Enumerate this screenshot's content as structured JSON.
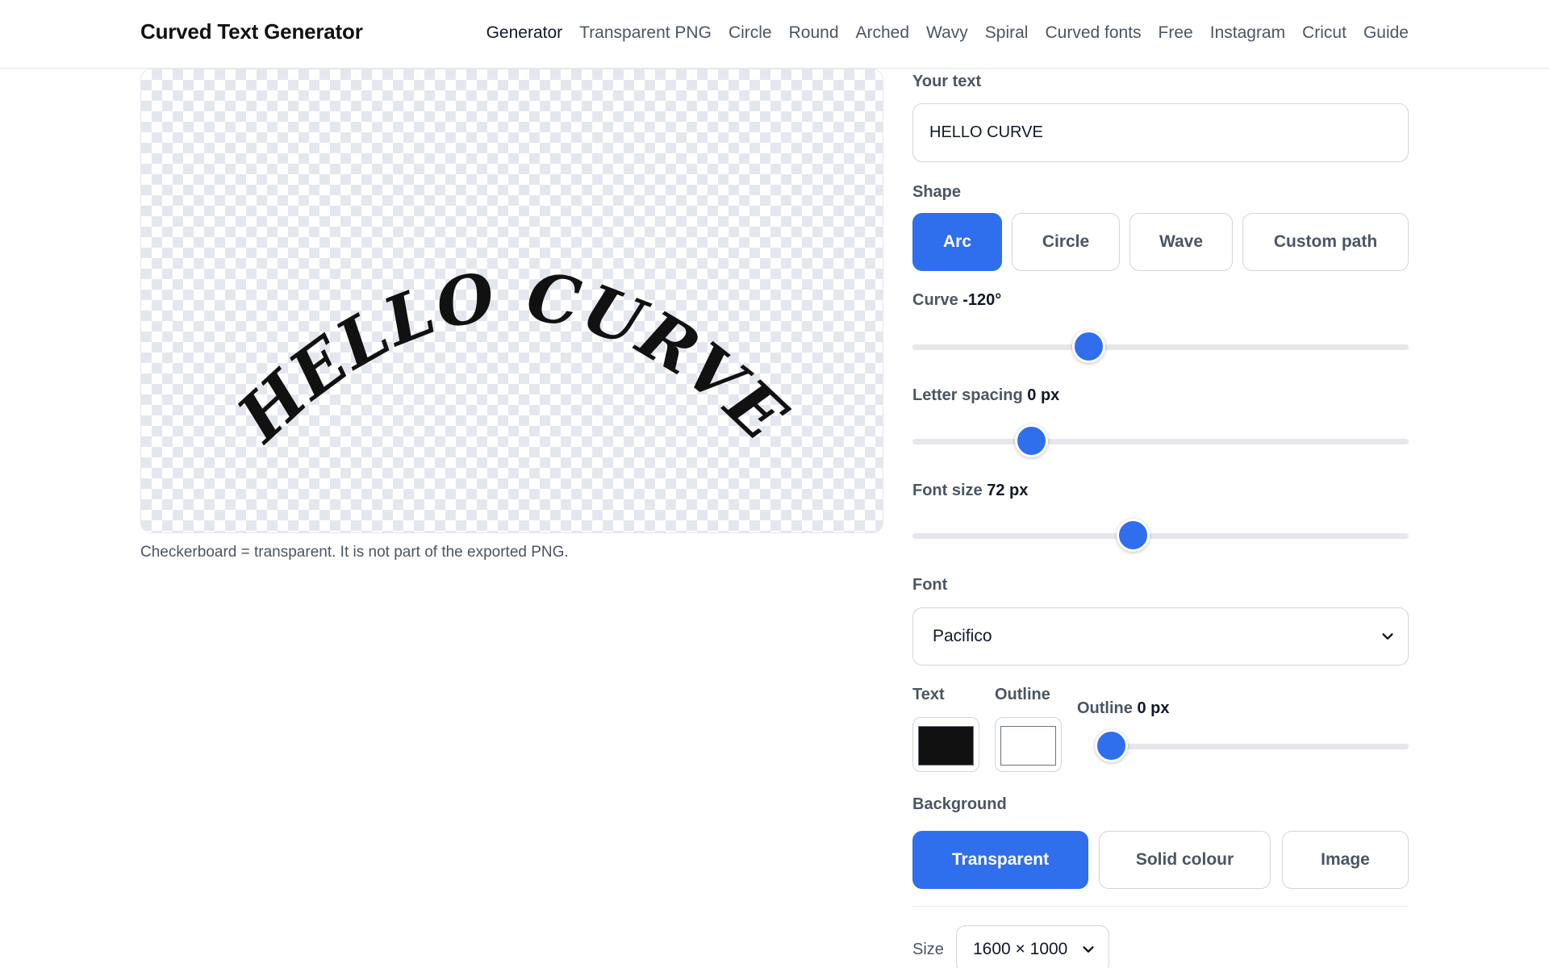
{
  "header": {
    "brand": "Curved Text Generator",
    "nav": [
      "Generator",
      "Transparent PNG",
      "Circle",
      "Round",
      "Arched",
      "Wavy",
      "Spiral",
      "Curved fonts",
      "Free",
      "Instagram",
      "Cricut",
      "Guide"
    ],
    "active_nav": "Generator"
  },
  "preview": {
    "text": "HELLO CURVE",
    "caption": "Checkerboard = transparent. It is not part of the exported PNG."
  },
  "controls": {
    "your_text": {
      "label": "Your text",
      "value": "HELLO CURVE"
    },
    "shape": {
      "label": "Shape",
      "options": [
        "Arc",
        "Circle",
        "Wave",
        "Custom path"
      ],
      "selected": "Arc"
    },
    "curve": {
      "label": "Curve",
      "value": "-120°",
      "fraction": 0.345
    },
    "letter_spacing": {
      "label": "Letter spacing",
      "value": "0 px",
      "fraction": 0.22
    },
    "font_size": {
      "label": "Font size",
      "value": "72 px",
      "fraction": 0.44
    },
    "font": {
      "label": "Font",
      "value": "Pacifico"
    },
    "colors": {
      "text_label": "Text",
      "outline_label": "Outline",
      "text_color": "#111111",
      "outline_color": "#ffffff"
    },
    "outline": {
      "label": "Outline",
      "value": "0 px",
      "fraction": 0.0
    },
    "background": {
      "label": "Background",
      "options": [
        "Transparent",
        "Solid colour",
        "Image"
      ],
      "selected": "Transparent"
    },
    "size": {
      "label": "Size",
      "value": "1600 × 1000"
    }
  },
  "colors": {
    "accent": "#2f6fed",
    "text": "#111827",
    "muted": "#4b5563",
    "border": "#d1d5db"
  }
}
